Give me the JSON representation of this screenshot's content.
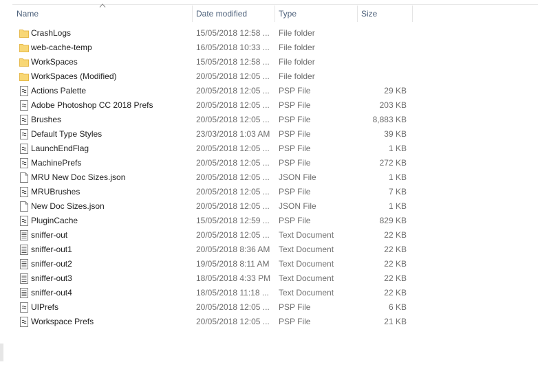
{
  "columns": {
    "name": "Name",
    "date": "Date modified",
    "type": "Type",
    "size": "Size"
  },
  "icon_colors": {
    "folder": "#f8d775",
    "folder_edge": "#e6b94a",
    "file_edge": "#808080"
  },
  "files": [
    {
      "name": "CrashLogs",
      "date": "15/05/2018 12:58 ...",
      "type": "File folder",
      "size": "",
      "icon": "folder-icon"
    },
    {
      "name": "web-cache-temp",
      "date": "16/05/2018 10:33 ...",
      "type": "File folder",
      "size": "",
      "icon": "folder-icon"
    },
    {
      "name": "WorkSpaces",
      "date": "15/05/2018 12:58 ...",
      "type": "File folder",
      "size": "",
      "icon": "folder-icon"
    },
    {
      "name": "WorkSpaces (Modified)",
      "date": "20/05/2018 12:05 ...",
      "type": "File folder",
      "size": "",
      "icon": "folder-icon"
    },
    {
      "name": "Actions Palette",
      "date": "20/05/2018 12:05 ...",
      "type": "PSP File",
      "size": "29 KB",
      "icon": "psp-file-icon"
    },
    {
      "name": "Adobe Photoshop CC 2018 Prefs",
      "date": "20/05/2018 12:05 ...",
      "type": "PSP File",
      "size": "203 KB",
      "icon": "psp-file-icon"
    },
    {
      "name": "Brushes",
      "date": "20/05/2018 12:05 ...",
      "type": "PSP File",
      "size": "8,883 KB",
      "icon": "psp-file-icon"
    },
    {
      "name": "Default Type Styles",
      "date": "23/03/2018 1:03 AM",
      "type": "PSP File",
      "size": "39 KB",
      "icon": "psp-file-icon"
    },
    {
      "name": "LaunchEndFlag",
      "date": "20/05/2018 12:05 ...",
      "type": "PSP File",
      "size": "1 KB",
      "icon": "psp-file-icon"
    },
    {
      "name": "MachinePrefs",
      "date": "20/05/2018 12:05 ...",
      "type": "PSP File",
      "size": "272 KB",
      "icon": "psp-file-icon"
    },
    {
      "name": "MRU New Doc Sizes.json",
      "date": "20/05/2018 12:05 ...",
      "type": "JSON File",
      "size": "1 KB",
      "icon": "blank-file-icon"
    },
    {
      "name": "MRUBrushes",
      "date": "20/05/2018 12:05 ...",
      "type": "PSP File",
      "size": "7 KB",
      "icon": "psp-file-icon"
    },
    {
      "name": "New Doc Sizes.json",
      "date": "20/05/2018 12:05 ...",
      "type": "JSON File",
      "size": "1 KB",
      "icon": "blank-file-icon"
    },
    {
      "name": "PluginCache",
      "date": "15/05/2018 12:59 ...",
      "type": "PSP File",
      "size": "829 KB",
      "icon": "psp-file-icon"
    },
    {
      "name": "sniffer-out",
      "date": "20/05/2018 12:05 ...",
      "type": "Text Document",
      "size": "22 KB",
      "icon": "text-file-icon"
    },
    {
      "name": "sniffer-out1",
      "date": "20/05/2018 8:36 AM",
      "type": "Text Document",
      "size": "22 KB",
      "icon": "text-file-icon"
    },
    {
      "name": "sniffer-out2",
      "date": "19/05/2018 8:11 AM",
      "type": "Text Document",
      "size": "22 KB",
      "icon": "text-file-icon"
    },
    {
      "name": "sniffer-out3",
      "date": "18/05/2018 4:33 PM",
      "type": "Text Document",
      "size": "22 KB",
      "icon": "text-file-icon"
    },
    {
      "name": "sniffer-out4",
      "date": "18/05/2018 11:18 ...",
      "type": "Text Document",
      "size": "22 KB",
      "icon": "text-file-icon"
    },
    {
      "name": "UIPrefs",
      "date": "20/05/2018 12:05 ...",
      "type": "PSP File",
      "size": "6 KB",
      "icon": "psp-file-icon"
    },
    {
      "name": "Workspace Prefs",
      "date": "20/05/2018 12:05 ...",
      "type": "PSP File",
      "size": "21 KB",
      "icon": "psp-file-icon"
    }
  ]
}
